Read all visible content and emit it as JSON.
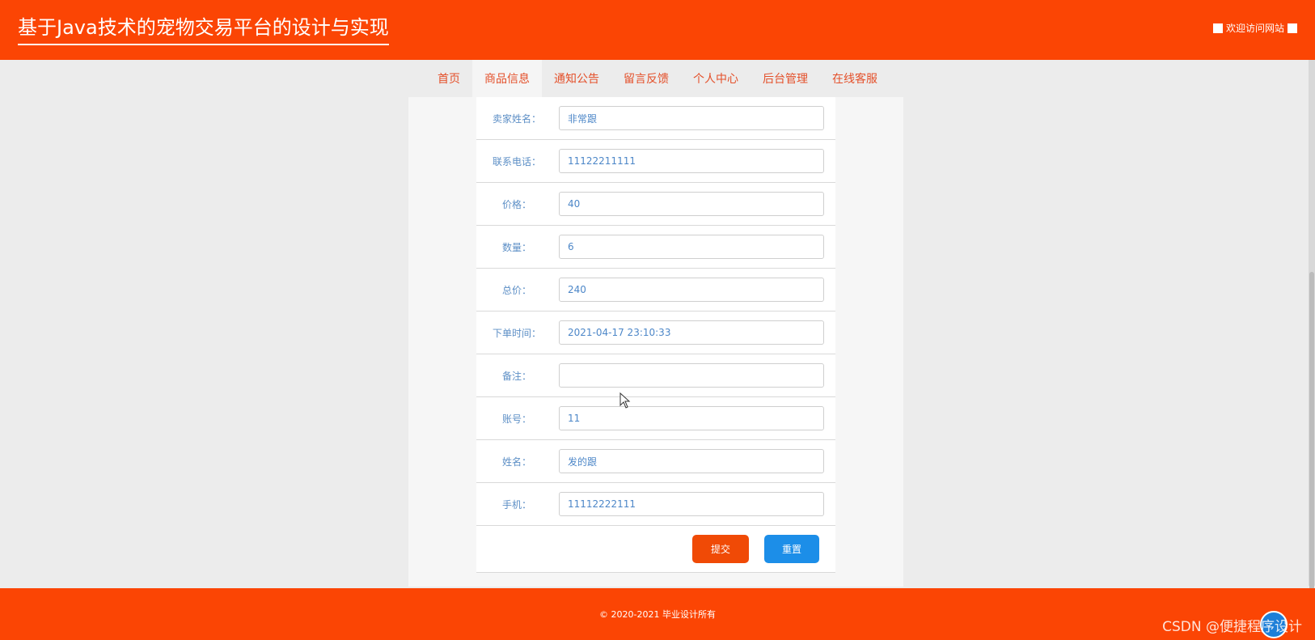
{
  "header": {
    "title": "基于Java技术的宠物交易平台的设计与实现",
    "welcome": "欢迎访问网站"
  },
  "nav": {
    "items": [
      {
        "label": "首页",
        "active": false
      },
      {
        "label": "商品信息",
        "active": true
      },
      {
        "label": "通知公告",
        "active": false
      },
      {
        "label": "留言反馈",
        "active": false
      },
      {
        "label": "个人中心",
        "active": false
      },
      {
        "label": "后台管理",
        "active": false
      },
      {
        "label": "在线客服",
        "active": false
      }
    ]
  },
  "form": {
    "fields": [
      {
        "label": "卖家姓名：",
        "value": "非常跟"
      },
      {
        "label": "联系电话：",
        "value": "11122211111"
      },
      {
        "label": "价格：",
        "value": "40"
      },
      {
        "label": "数量：",
        "value": "6"
      },
      {
        "label": "总价：",
        "value": "240"
      },
      {
        "label": "下单时间：",
        "value": "2021-04-17 23:10:33"
      },
      {
        "label": "备注：",
        "value": ""
      },
      {
        "label": "账号：",
        "value": "11"
      },
      {
        "label": "姓名：",
        "value": "发的跟"
      },
      {
        "label": "手机：",
        "value": "11112222111"
      }
    ],
    "submit_label": "提交",
    "reset_label": "重置"
  },
  "footer": {
    "copyright": "© 2020-2021 毕业设计所有"
  },
  "watermark": "CSDN @便捷程序设计",
  "colors": {
    "brand": "#fb4504",
    "label_text": "#5d8fc6",
    "submit": "#f04a06",
    "reset": "#1c8ee8"
  }
}
